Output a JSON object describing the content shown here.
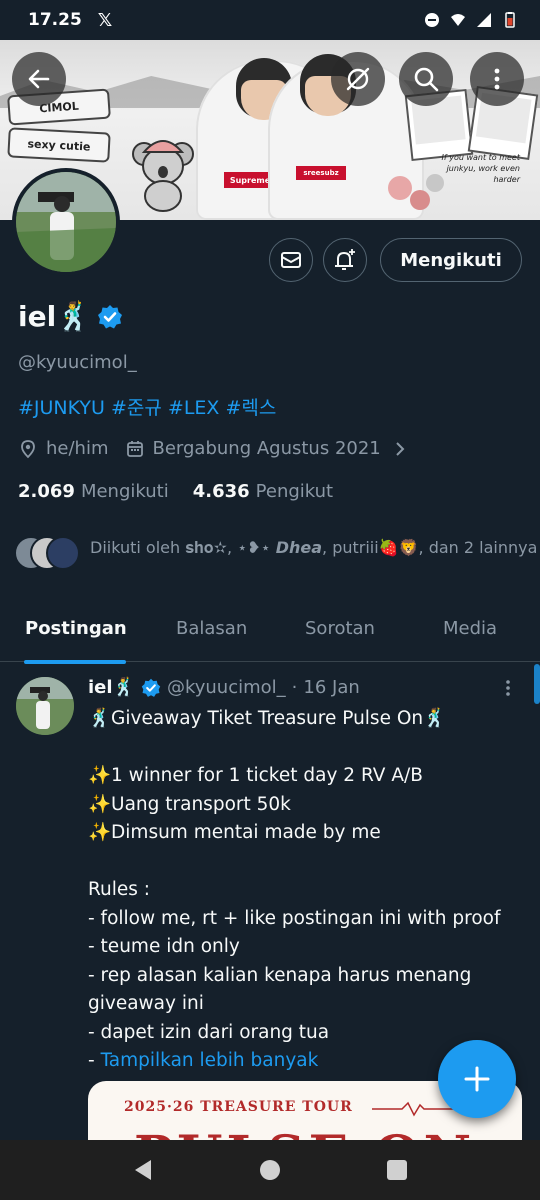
{
  "status_bar": {
    "time": "17.25",
    "app_icon": "x-logo-icon",
    "x_glyph": "𝕏"
  },
  "banner": {
    "sign_top": "CIMOL",
    "sign_bottom": "sexy cutie",
    "shirt_left": "Supreme",
    "shirt_right": "sreesubz",
    "caption": "If you want to meet junkyu, work even harder"
  },
  "profile": {
    "name": "iel🕺",
    "handle": "@kyuucimol_",
    "bio": "#JUNKYU #준규 #LEX #렉스",
    "pronouns": "he/him",
    "joined": "Bergabung Agustus 2021",
    "following_count": "2.069",
    "following_label": "Mengikuti",
    "followers_count": "4.636",
    "followers_label": "Pengikut",
    "followed_by": "Diikuti oleh 𝐬𝐡𝐨✫, ⋆❥⋆ 𝘿𝙝𝙚𝙖, putriii🍓🦁, dan 2 lainnya",
    "follow_button": "Mengikuti",
    "verified_color": "#1d9bf0"
  },
  "tabs": [
    {
      "label": "Postingan",
      "active": true
    },
    {
      "label": "Balasan",
      "active": false
    },
    {
      "label": "Sorotan",
      "active": false
    },
    {
      "label": "Media",
      "active": false
    }
  ],
  "post": {
    "author": "iel🕺",
    "handle": "@kyuucimol_",
    "separator": "·",
    "date": "16 Jan",
    "body": "🕺Giveaway Tiket Treasure Pulse On🕺\n\n✨1 winner for 1 ticket day 2 RV A/B\n✨Uang transport 50k\n✨Dimsum mentai made by me\n\nRules :\n- follow me, rt + like postingan ini with proof\n- teume idn only\n- rep alasan kalian kenapa harus menang giveaway ini\n- dapet izin dari orang tua\n- ",
    "more": "Tampilkan lebih banyak",
    "image_tour": "2025·26 TREASURE TOUR",
    "image_big": "PULSE ON"
  },
  "colors": {
    "accent": "#1d9bf0",
    "background": "#15202b",
    "muted": "#8b98a5"
  }
}
